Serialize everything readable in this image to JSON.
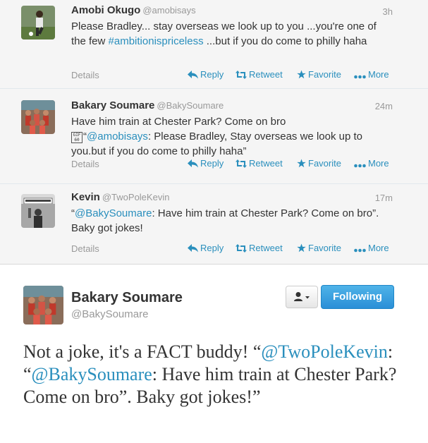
{
  "tweets": [
    {
      "avatar": "soccer-player-avatar",
      "name": "Amobi Okugo",
      "handle": "@amobisays",
      "time": "3h",
      "text": {
        "part1": "Please Bradley... stay overseas we look up to you ...you're one of the few ",
        "hashtag": "#ambitionispriceless",
        "part2": " ...but if you do come to philly haha"
      }
    },
    {
      "avatar": "team-photo-avatar",
      "name": "Bakary Soumare",
      "handle": "@BakySoumare",
      "time": "24m",
      "text": {
        "part1": "Have him train at Chester Park? Come on bro",
        "emoji": "GIF 60",
        "quote_open": "“",
        "mention": "@amobisays",
        "part2": ": Please Bradley, Stay overseas we look up to you.but if you do come to philly haha”"
      }
    },
    {
      "avatar": "philadelphia-photo-avatar",
      "name": "Kevin",
      "handle": "@TwoPoleKevin",
      "time": "17m",
      "text": {
        "quote_open": "“",
        "mention": "@BakySoumare",
        "part2": ": Have him train at Chester Park? Come on bro”.  Baky got jokes!"
      }
    }
  ],
  "actions": {
    "details": "Details",
    "reply": "Reply",
    "retweet": "Retweet",
    "favorite": "Favorite",
    "more": "More"
  },
  "expanded": {
    "name": "Bakary Soumare",
    "handle": "@BakySoumare",
    "follow_label": "Following",
    "user_menu_icon": "user-dropdown-icon",
    "text": {
      "part1": "Not a joke, it's a FACT buddy! “",
      "mention1": "@TwoPoleKevin",
      "part2": ": “",
      "mention2": "@BakySoumare",
      "part3": ": Have him train at Chester Park? Come on bro”. Baky got jokes!”"
    }
  },
  "colors": {
    "link": "#2a8fbd",
    "follow_button": "#2a8fd7",
    "muted": "#999999"
  }
}
